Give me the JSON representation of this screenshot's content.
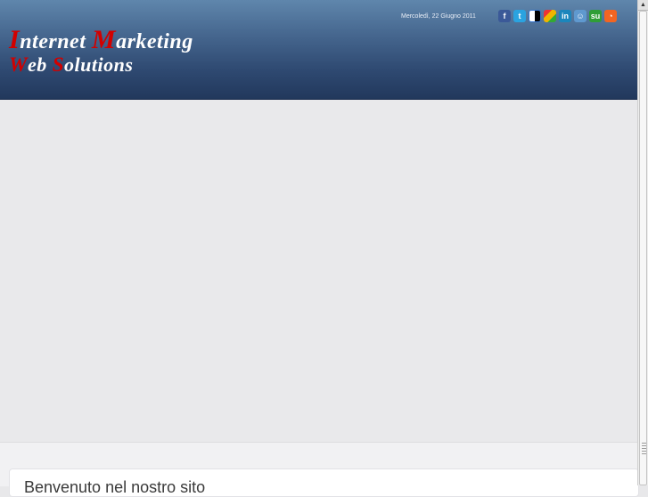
{
  "header": {
    "logo": {
      "line1": [
        {
          "cap": "I",
          "rest": "nternet "
        },
        {
          "cap": "M",
          "rest": "arketing"
        }
      ],
      "line2": [
        {
          "cap": "W",
          "rest": "eb "
        },
        {
          "cap": "S",
          "rest": "olutions"
        }
      ]
    },
    "date": "Mercoledì, 22 Giugno 2011",
    "social": [
      {
        "name": "facebook-icon",
        "glyph": "f",
        "color": "#3b5998"
      },
      {
        "name": "twitter-icon",
        "glyph": "t",
        "color": "#2aa3e0"
      },
      {
        "name": "delicious-icon",
        "glyph": "",
        "color": "#3274d1"
      },
      {
        "name": "google-buzz-icon",
        "glyph": "",
        "color": "#f1b400"
      },
      {
        "name": "linkedin-icon",
        "glyph": "in",
        "color": "#1b86bc"
      },
      {
        "name": "reddit-icon",
        "glyph": "☺",
        "color": "#5f99cf"
      },
      {
        "name": "stumbleupon-icon",
        "glyph": "su",
        "color": "#2f9e37"
      },
      {
        "name": "rss-icon",
        "glyph": "◔",
        "color": "#f26522"
      }
    ]
  },
  "main": {
    "card_title": "Benvenuto nel nostro sito"
  }
}
